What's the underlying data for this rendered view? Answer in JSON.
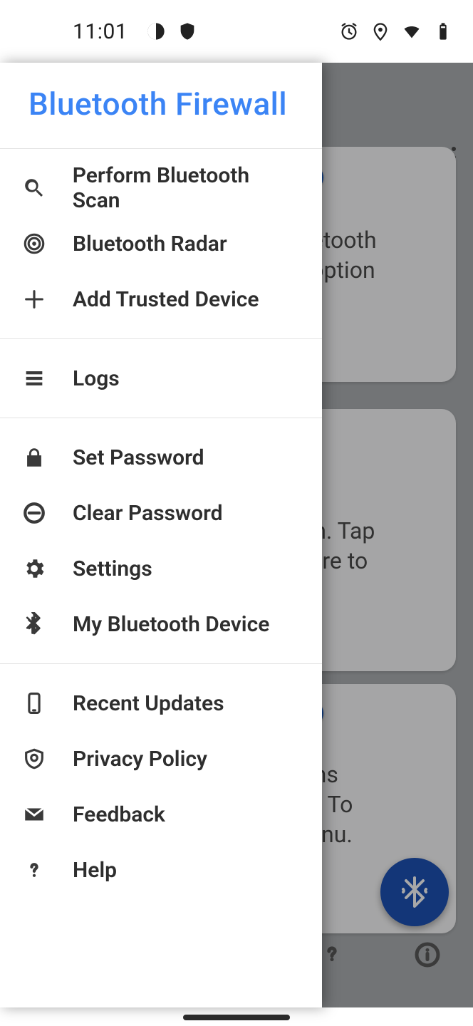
{
  "statusbar": {
    "time": "11:01"
  },
  "drawer": {
    "title": "Bluetooth Firewall",
    "items": {
      "scan": "Perform Bluetooth Scan",
      "radar": "Bluetooth Radar",
      "add_trusted": "Add Trusted Device",
      "logs": "Logs",
      "set_password": "Set Password",
      "clear_password": "Clear Password",
      "settings": "Settings",
      "my_device": "My Bluetooth Device",
      "recent_updates": "Recent Updates",
      "privacy_policy": "Privacy Policy",
      "feedback": "Feedback",
      "help": "Help"
    }
  },
  "background": {
    "card1_text": "ll bluetooth\nvide option",
    "card2_text": "n an\nection. Tap\nfo there to",
    "card3_text": "actions\nevice. To\nm menu.",
    "toggle1": true,
    "toggle2": false,
    "toggle3": true
  }
}
